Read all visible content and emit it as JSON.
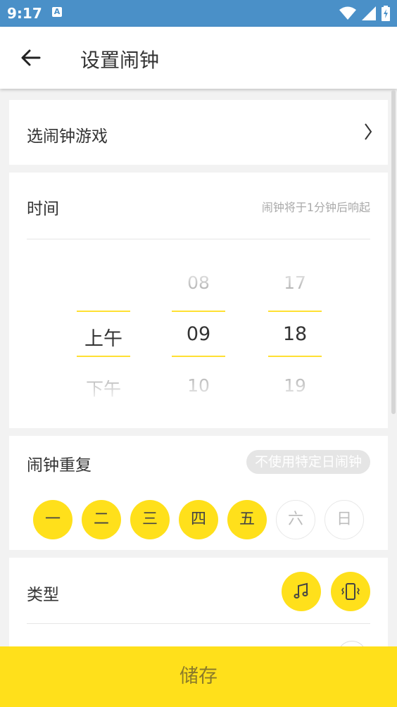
{
  "status": {
    "time": "9:17",
    "badge": "A"
  },
  "appbar": {
    "title": "设置闹钟"
  },
  "game": {
    "label": "选闹钟游戏",
    "chevron": "〉"
  },
  "time": {
    "label": "时间",
    "hint": "闹钟将于1分钟后响起",
    "ampm": {
      "prev": "",
      "selected": "上午",
      "next": "下午"
    },
    "hour": {
      "prev": "08",
      "selected": "09",
      "next": "10"
    },
    "minute": {
      "prev": "17",
      "selected": "18",
      "next": "19"
    }
  },
  "repeat": {
    "label": "闹钟重复",
    "specific_day": "不使用特定日闹钟",
    "days": [
      {
        "label": "一",
        "active": true
      },
      {
        "label": "二",
        "active": true
      },
      {
        "label": "三",
        "active": true
      },
      {
        "label": "四",
        "active": true
      },
      {
        "label": "五",
        "active": true
      },
      {
        "label": "六",
        "active": false
      },
      {
        "label": "日",
        "active": false
      }
    ]
  },
  "type": {
    "label": "类型",
    "icons": [
      "music-icon",
      "vibrate-icon"
    ]
  },
  "save": {
    "label": "储存"
  },
  "colors": {
    "accent": "#ffe01b",
    "statusbar": "#4a90c8"
  }
}
